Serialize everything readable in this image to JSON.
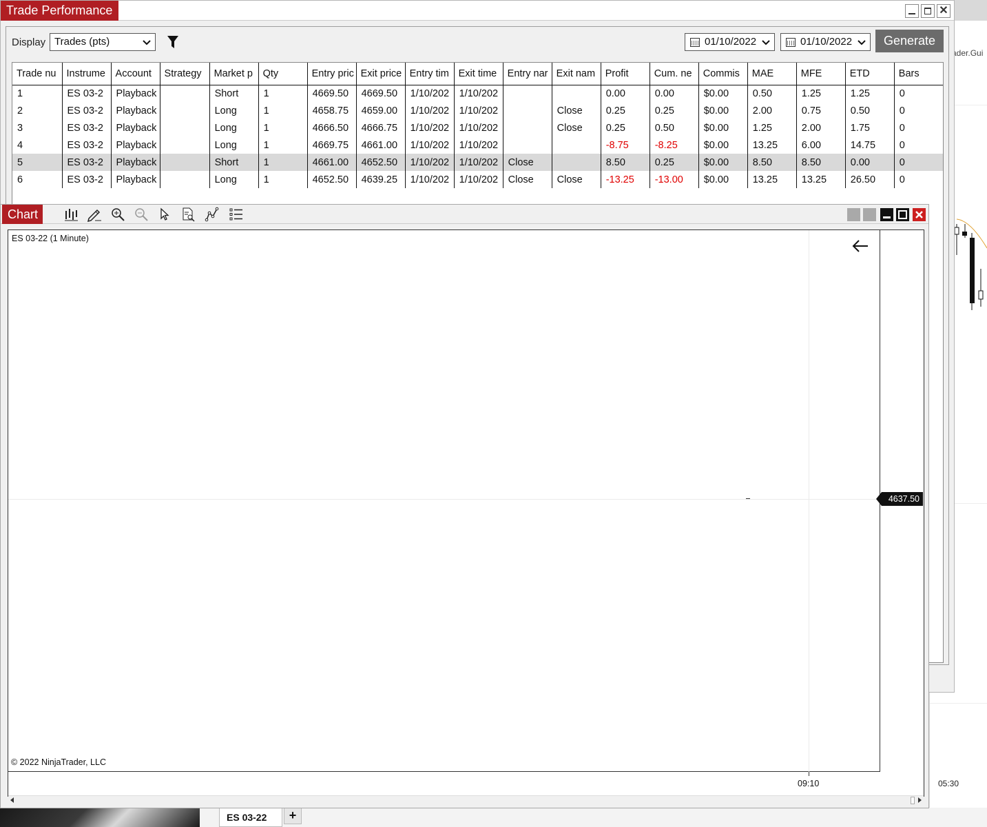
{
  "trade_performance": {
    "title": "Trade Performance",
    "display_label": "Display",
    "display_value": "Trades (pts)",
    "date_from": "01/10/2022",
    "date_to": "01/10/2022",
    "generate_label": "Generate",
    "columns": [
      "Trade nu",
      "Instrume",
      "Account",
      "Strategy",
      "Market p",
      "Qty",
      "Entry pric",
      "Exit price",
      "Entry tim",
      "Exit time",
      "Entry nar",
      "Exit nam",
      "Profit",
      "Cum. ne",
      "Commis",
      "MAE",
      "MFE",
      "ETD",
      "Bars"
    ],
    "rows": [
      [
        "1",
        "ES 03-2",
        "Playback",
        "",
        "Short",
        "1",
        "4669.50",
        "4669.50",
        "1/10/202",
        "1/10/202",
        "",
        "",
        "0.00",
        "0.00",
        "$0.00",
        "0.50",
        "1.25",
        "1.25",
        "0"
      ],
      [
        "2",
        "ES 03-2",
        "Playback",
        "",
        "Long",
        "1",
        "4658.75",
        "4659.00",
        "1/10/202",
        "1/10/202",
        "",
        "Close",
        "0.25",
        "0.25",
        "$0.00",
        "2.00",
        "0.75",
        "0.50",
        "0"
      ],
      [
        "3",
        "ES 03-2",
        "Playback",
        "",
        "Long",
        "1",
        "4666.50",
        "4666.75",
        "1/10/202",
        "1/10/202",
        "",
        "Close",
        "0.25",
        "0.50",
        "$0.00",
        "1.25",
        "2.00",
        "1.75",
        "0"
      ],
      [
        "4",
        "ES 03-2",
        "Playback",
        "",
        "Long",
        "1",
        "4669.75",
        "4661.00",
        "1/10/202",
        "1/10/202",
        "",
        "",
        "-8.75",
        "-8.25",
        "$0.00",
        "13.25",
        "6.00",
        "14.75",
        "0"
      ],
      [
        "5",
        "ES 03-2",
        "Playback",
        "",
        "Short",
        "1",
        "4661.00",
        "4652.50",
        "1/10/202",
        "1/10/202",
        "Close",
        "",
        "8.50",
        "0.25",
        "$0.00",
        "8.50",
        "8.50",
        "0.00",
        "0"
      ],
      [
        "6",
        "ES 03-2",
        "Playback",
        "",
        "Long",
        "1",
        "4652.50",
        "4639.25",
        "1/10/202",
        "1/10/202",
        "Close",
        "Close",
        "-13.25",
        "-13.00",
        "$0.00",
        "13.25",
        "13.25",
        "26.50",
        "0"
      ]
    ],
    "selected_row": 4,
    "negative_color": "#e00000"
  },
  "chart": {
    "title": "Chart",
    "instrument_label": "ES 03-22 (1 Minute)",
    "copyright": "© 2022 NinjaTrader, LLC",
    "price_label": "4637.50",
    "time_label": "09:10",
    "toolbar_icons": [
      "bar-type-icon",
      "drawing-pencil-icon",
      "zoom-in-icon",
      "zoom-out-icon",
      "pointer-icon",
      "properties-icon",
      "strategy-icon",
      "list-icon"
    ]
  },
  "background": {
    "app_label": "ader.Gui",
    "time_label": "05:30",
    "tab_label": "ES 03-22",
    "tab_add": "+"
  },
  "colors": {
    "title_accent": "#b01e23",
    "generate_bg": "#6b6b6b",
    "selected_row_bg": "#d9d9d9"
  }
}
